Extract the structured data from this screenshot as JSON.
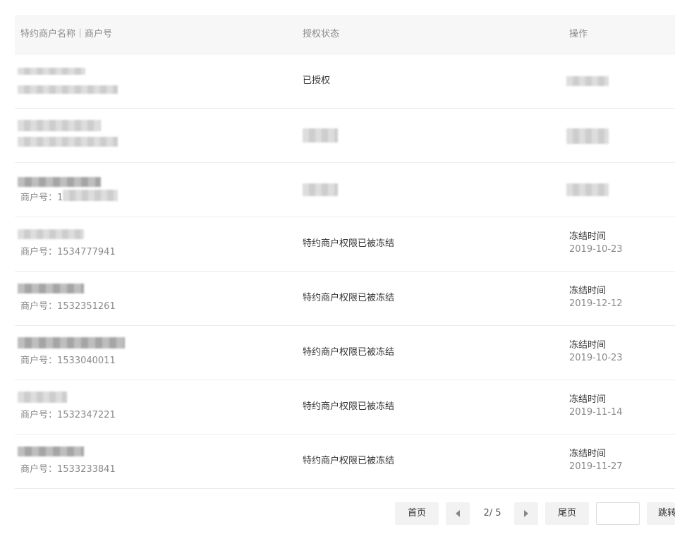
{
  "table": {
    "headers": {
      "name": "特约商户名称｜商户号",
      "status": "授权状态",
      "action": "操作"
    },
    "rows": [
      {
        "status": "已授权"
      },
      {},
      {
        "merchant_prefix": "商户号：15352"
      },
      {
        "merchant_no": "商户号：1534777941",
        "status": "特约商户权限已被冻结",
        "action_label": "冻结时间",
        "action_date": "2019-10-23"
      },
      {
        "merchant_no": "商户号：1532351261",
        "status": "特约商户权限已被冻结",
        "action_label": "冻结时间",
        "action_date": "2019-12-12"
      },
      {
        "merchant_no": "商户号：1533040011",
        "status": "特约商户权限已被冻结",
        "action_label": "冻结时间",
        "action_date": "2019-10-23"
      },
      {
        "merchant_no": "商户号：1532347221",
        "status": "特约商户权限已被冻结",
        "action_label": "冻结时间",
        "action_date": "2019-11-14"
      },
      {
        "merchant_no": "商户号：1533233841",
        "status": "特约商户权限已被冻结",
        "action_label": "冻结时间",
        "action_date": "2019-11-27"
      }
    ]
  },
  "pagination": {
    "first_label": "首页",
    "page_info": "2/ 5",
    "last_label": "尾页",
    "jump_label": "跳转",
    "jump_input_value": "",
    "prev_icon": "triangle-left-icon",
    "next_icon": "triangle-right-icon"
  },
  "colors": {
    "header_bg": "#f7f7f7",
    "border": "#ececec",
    "muted_text": "#8a8a8a",
    "button_bg": "#f2f2f2"
  }
}
